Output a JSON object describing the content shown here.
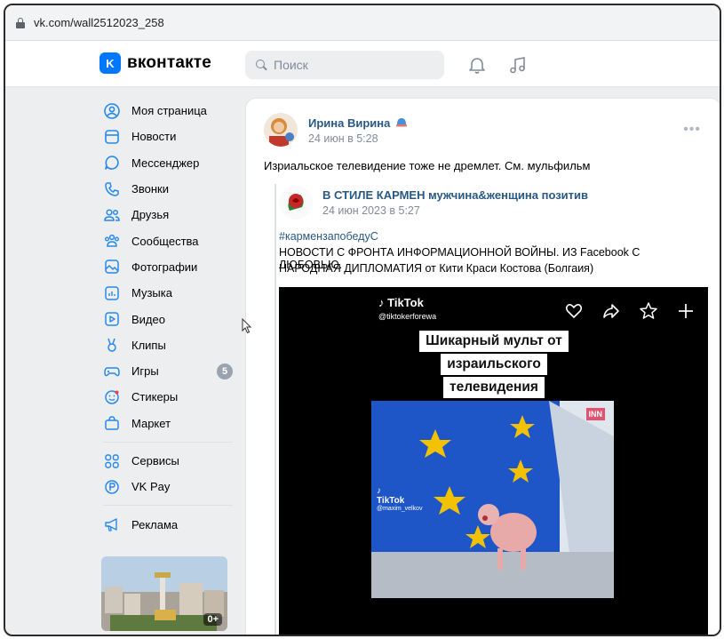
{
  "browser": {
    "url": "vk.com/wall2512023_258"
  },
  "header": {
    "logo_text": "вконтакте",
    "logo_letter": "K",
    "search_placeholder": "Поиск"
  },
  "menu": {
    "items": [
      {
        "label": "Моя страница",
        "icon": "user-circle-icon"
      },
      {
        "label": "Новости",
        "icon": "news-icon"
      },
      {
        "label": "Мессенджер",
        "icon": "messenger-icon"
      },
      {
        "label": "Звонки",
        "icon": "phone-icon"
      },
      {
        "label": "Друзья",
        "icon": "friends-icon"
      },
      {
        "label": "Сообщества",
        "icon": "communities-icon"
      },
      {
        "label": "Фотографии",
        "icon": "photos-icon"
      },
      {
        "label": "Музыка",
        "icon": "music-icon"
      },
      {
        "label": "Видео",
        "icon": "video-icon"
      },
      {
        "label": "Клипы",
        "icon": "clips-icon"
      },
      {
        "label": "Игры",
        "icon": "games-icon",
        "badge": "5"
      },
      {
        "label": "Стикеры",
        "icon": "stickers-icon"
      },
      {
        "label": "Маркет",
        "icon": "market-icon"
      }
    ],
    "services": [
      {
        "label": "Сервисы",
        "icon": "services-icon"
      },
      {
        "label": "VK Pay",
        "icon": "vkpay-icon"
      }
    ],
    "ads": {
      "label": "Реклама",
      "icon": "megaphone-icon",
      "age_badge": "0+"
    }
  },
  "post": {
    "author": "Ирина Вирина",
    "date": "24 июн в 5:28",
    "text": "Изриальское телевидение тоже не дремлет. См. мульфильм",
    "repost": {
      "author": "В СТИЛЕ КАРМЕН мужчина&женщина позитив",
      "date": "24 июн 2023 в 5:27",
      "hashtag": "#кармензапобедуС",
      "line1": "НОВОСТИ С ФРОНТА ИНФОРМАЦИОННОЙ ВОЙНЫ. ИЗ Facebook С ЛЮБОВЬЮ.",
      "line2": "НАРОДНАЯ ДИПЛОМАТИЯ от Кити Краси Костова (Болгаия)"
    },
    "video": {
      "brand": "TikTok",
      "user": "@tiktokerforewa",
      "caption": [
        "Шикарный мульт от",
        "израильского",
        "телевидения"
      ],
      "channel_tag": "INN",
      "inner_brand": "TikTok",
      "inner_user": "@maxim_velkov"
    }
  },
  "colors": {
    "accent": "#0077ff",
    "link": "#2a5885",
    "bg": "#edeef0",
    "muted": "#818c99"
  }
}
